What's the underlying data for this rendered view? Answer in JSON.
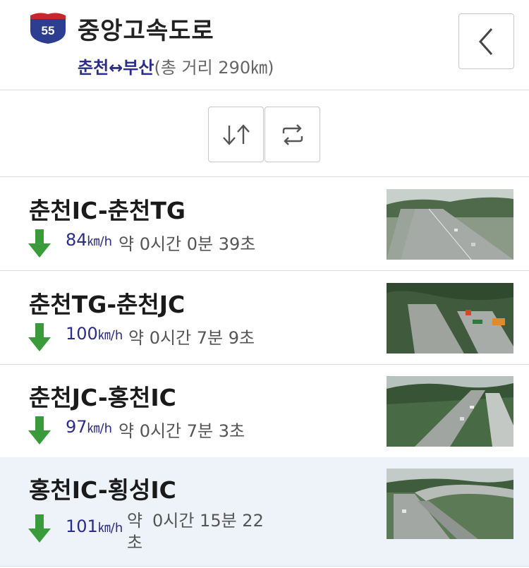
{
  "header": {
    "shield_number": "55",
    "road_name": "중앙고속도로",
    "route": "춘천↔부산",
    "distance": "(총 거리 290㎞)"
  },
  "colors": {
    "shield_blue": "#2d3d8f",
    "shield_red": "#c9252c",
    "speed_text": "#2c2c8a",
    "arrow_green": "#3a9b3a",
    "highlight_row": "#eef3f9"
  },
  "icons": {
    "back": "chevron-left-icon",
    "swap": "swap-direction-icon",
    "refresh": "refresh-icon",
    "status": "arrow-down-icon"
  },
  "segments": [
    {
      "title": "춘천IC-춘천TG",
      "speed": "84",
      "unit": "㎞/h",
      "eta": "약 0시간 0분 39초"
    },
    {
      "title": "춘천TG-춘천JC",
      "speed": "100",
      "unit": "㎞/h",
      "eta": "약 0시간 7분 9초"
    },
    {
      "title": "춘천JC-홍천IC",
      "speed": "97",
      "unit": "㎞/h",
      "eta": "약 0시간 7분 3초"
    },
    {
      "title": "홍천IC-횡성IC",
      "speed": "101",
      "unit": "㎞/h",
      "eta_a": "약",
      "eta_b": "0시간 15분 22",
      "eta_c": "초"
    }
  ]
}
